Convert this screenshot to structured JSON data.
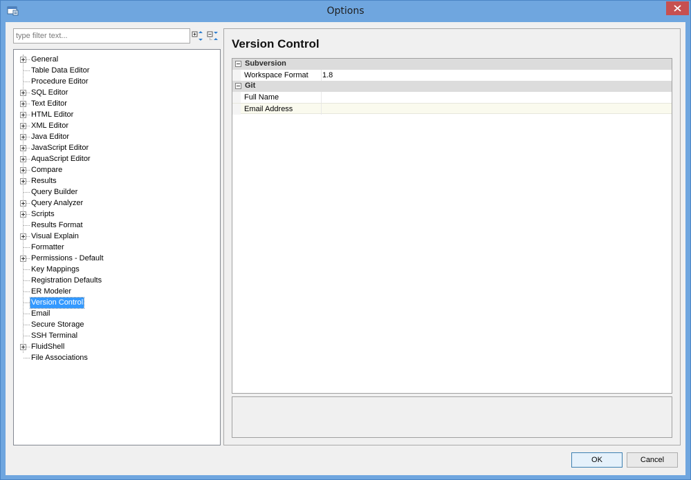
{
  "window": {
    "title": "Options"
  },
  "filter": {
    "placeholder": "type filter text..."
  },
  "tree": [
    {
      "label": "General",
      "expandable": true
    },
    {
      "label": "Table Data Editor",
      "expandable": false
    },
    {
      "label": "Procedure Editor",
      "expandable": false
    },
    {
      "label": "SQL Editor",
      "expandable": true
    },
    {
      "label": "Text Editor",
      "expandable": true
    },
    {
      "label": "HTML Editor",
      "expandable": true
    },
    {
      "label": "XML Editor",
      "expandable": true
    },
    {
      "label": "Java Editor",
      "expandable": true
    },
    {
      "label": "JavaScript Editor",
      "expandable": true
    },
    {
      "label": "AquaScript Editor",
      "expandable": true
    },
    {
      "label": "Compare",
      "expandable": true
    },
    {
      "label": "Results",
      "expandable": true
    },
    {
      "label": "Query Builder",
      "expandable": false
    },
    {
      "label": "Query Analyzer",
      "expandable": true
    },
    {
      "label": "Scripts",
      "expandable": true
    },
    {
      "label": "Results Format",
      "expandable": false
    },
    {
      "label": "Visual Explain",
      "expandable": true
    },
    {
      "label": "Formatter",
      "expandable": false
    },
    {
      "label": "Permissions - Default",
      "expandable": true
    },
    {
      "label": "Key Mappings",
      "expandable": false
    },
    {
      "label": "Registration Defaults",
      "expandable": false
    },
    {
      "label": "ER Modeler",
      "expandable": false
    },
    {
      "label": "Version Control",
      "expandable": false,
      "selected": true
    },
    {
      "label": "Email",
      "expandable": false
    },
    {
      "label": "Secure Storage",
      "expandable": false
    },
    {
      "label": "SSH Terminal",
      "expandable": false
    },
    {
      "label": "FluidShell",
      "expandable": true
    },
    {
      "label": "File Associations",
      "expandable": false
    }
  ],
  "page": {
    "title": "Version Control",
    "categories": [
      {
        "name": "Subversion",
        "props": [
          {
            "name": "Workspace Format",
            "value": "1.8"
          }
        ]
      },
      {
        "name": "Git",
        "props": [
          {
            "name": "Full Name",
            "value": ""
          },
          {
            "name": "Email Address",
            "value": ""
          }
        ]
      }
    ]
  },
  "buttons": {
    "ok": "OK",
    "cancel": "Cancel"
  },
  "icons": {
    "app": "app-icon",
    "close": "close-icon",
    "expand_all": "expand-all-icon",
    "collapse_all": "collapse-all-icon"
  },
  "colors": {
    "selection": "#3399ff",
    "close": "#c75050",
    "frame": "#6fa6df"
  }
}
